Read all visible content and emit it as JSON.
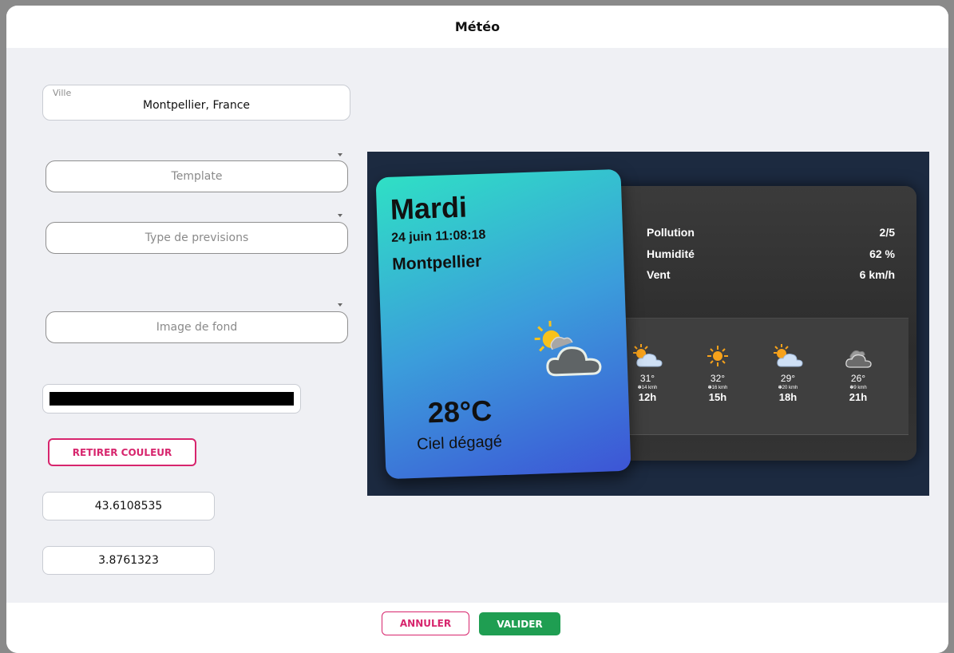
{
  "modal": {
    "title": "Météo"
  },
  "form": {
    "city": {
      "label": "Ville",
      "value": "Montpellier, France"
    },
    "template": {
      "placeholder": "Template"
    },
    "forecast_type": {
      "placeholder": "Type de previsions"
    },
    "background_image": {
      "placeholder": "Image de fond"
    },
    "color": {
      "value": "#000000"
    },
    "remove_color_label": "RETIRER COULEUR",
    "latitude": "43.6108535",
    "longitude": "3.8761323"
  },
  "footer": {
    "cancel_label": "ANNULER",
    "confirm_label": "VALIDER"
  },
  "colors": {
    "accent_pink": "#d7256d",
    "confirm_green": "#1f9e52"
  },
  "preview": {
    "day": "Mardi",
    "datetime": "24 juin 11:08:18",
    "city": "Montpellier",
    "current_icon": "partly-cloudy-icon",
    "temperature": "28°C",
    "condition": "Ciel dégagé",
    "stats": [
      {
        "label": "Pollution",
        "value": "2/5"
      },
      {
        "label": "Humidité",
        "value": "62 %"
      },
      {
        "label": "Vent",
        "value": "6 km/h"
      }
    ],
    "forecast": [
      {
        "icon": "sun-cloud-icon",
        "temp": "31°",
        "wind": "14 kmh",
        "hour": "12h"
      },
      {
        "icon": "sun-icon",
        "temp": "32°",
        "wind": "16 kmh",
        "hour": "15h"
      },
      {
        "icon": "sun-cloud-icon",
        "temp": "29°",
        "wind": "20 kmh",
        "hour": "18h"
      },
      {
        "icon": "cloud-icon",
        "temp": "26°",
        "wind": "9 kmh",
        "hour": "21h"
      }
    ]
  }
}
